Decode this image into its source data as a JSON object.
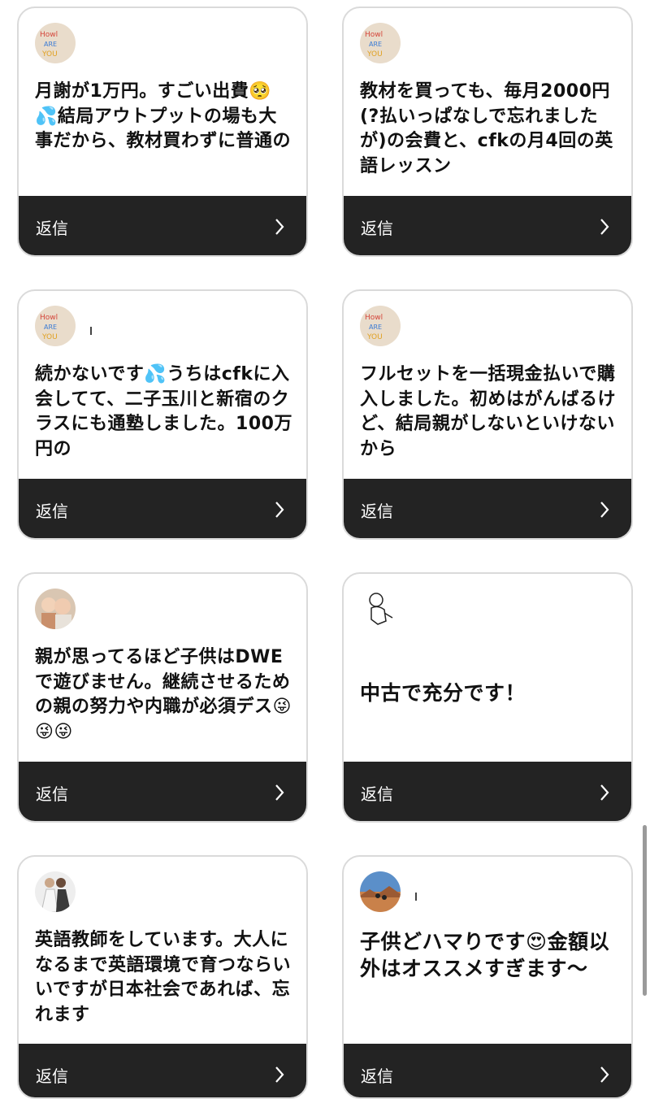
{
  "reply_label": "返信",
  "comments": [
    {
      "avatar": "howl-are-you-avatar",
      "text": "月謝が1万円。すごい出費🥺💦結局アウトプットの場も大事だから、教材買わずに普通の"
    },
    {
      "avatar": "howl-are-you-avatar",
      "text": "教材を買っても、毎月2000円(?払いっぱなしで忘れましたが)の会費と、cfkの月4回の英語レッスン"
    },
    {
      "avatar": "howl-are-you-avatar",
      "text": "続かないです💦うちはcfkに入会してて、二子玉川と新宿のクラスにも通塾しました。100万円の"
    },
    {
      "avatar": "howl-are-you-avatar",
      "text": "フルセットを一括現金払いで購入しました。初めはがんばるけど、結局親がしないといけないから"
    },
    {
      "avatar": "baby-photo-avatar",
      "text": "親が思ってるほど子供はDWEで遊びません。継続させるための親の努力や内職が必須デス😜😜😜"
    },
    {
      "avatar": "baby-sketch-avatar",
      "text": "中古で充分です！"
    },
    {
      "avatar": "wedding-photo-avatar",
      "text": "英語教師をしています。大人になるまで英語環境で育つならいいですが日本社会であれば、忘れます"
    },
    {
      "avatar": "desert-photo-avatar",
      "text": "子供どハマりです😍金額以外はオススメすぎます〜"
    }
  ],
  "colors": {
    "reply_bar": "#232323",
    "card_border": "#dadada"
  }
}
